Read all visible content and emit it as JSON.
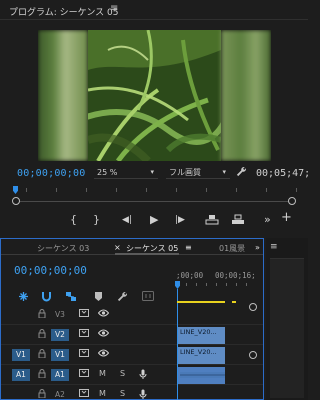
{
  "monitor": {
    "title": "プログラム: シーケンス 05",
    "menu_icon": "hamburger-icon",
    "timecode_current": "00;00;00;00",
    "zoom": "25 %",
    "quality": "フル画質",
    "timecode_duration": "00;05;47;",
    "controls": {
      "mark_in": "{",
      "mark_out": "}",
      "step_back": "◀|",
      "play": "▶",
      "step_forward": "|▶",
      "lift": "lift-icon",
      "extract": "extract-icon",
      "more": "»",
      "add": "+"
    }
  },
  "timeline": {
    "tabs": [
      {
        "label": "シーケンス 03"
      },
      {
        "label": "シーケンス 05",
        "close": "×",
        "menu": "≡"
      },
      {
        "label": "01風景"
      }
    ],
    "overflow": "»",
    "timecode": "00;00;00;00",
    "ruler_labels": [
      ";00;00",
      "00;00;16;"
    ],
    "tracks": [
      {
        "id": "V3",
        "source": "",
        "target": "V3",
        "clip": ""
      },
      {
        "id": "V2",
        "source": "",
        "target": "V2",
        "clip": "LINE_V20..."
      },
      {
        "id": "V1",
        "source": "V1",
        "target": "V1",
        "clip": "LINE_V20..."
      },
      {
        "id": "A1",
        "source": "A1",
        "target": "A1",
        "mute": "M",
        "solo": "S",
        "clip": ""
      },
      {
        "id": "A2",
        "source": "",
        "target": "A2",
        "mute": "M",
        "solo": "S",
        "clip": ""
      }
    ]
  },
  "colors": {
    "accent_blue": "#3ea1f1",
    "track_patch_blue": "#2b5c8a",
    "clip_video": "#5f8cc4",
    "clip_audio": "#4f7fc0",
    "render_bar": "#e8d21e"
  }
}
